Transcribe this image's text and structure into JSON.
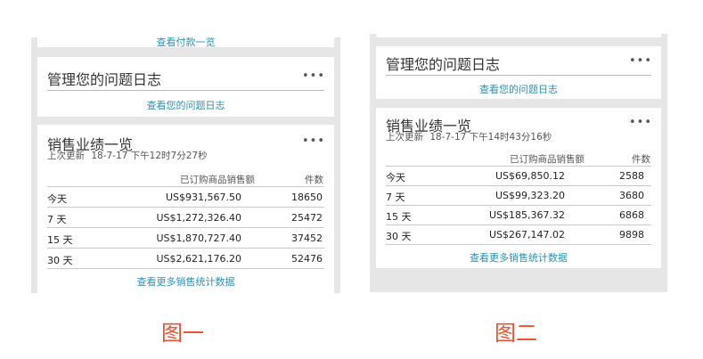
{
  "figure1": {
    "top_link": "查看付款一览",
    "issues_card": {
      "title": "管理您的问题日志",
      "more": "•••",
      "link": "查看您的问题日志"
    },
    "sales_card": {
      "title": "销售业绩一览",
      "more": "•••",
      "updated_label": "上次更新",
      "updated_value": "18-7-17 下午12时7分27秒",
      "col_sales": "已订购商品销售额",
      "col_count": "件数",
      "rows": [
        {
          "period": "今天",
          "amount": "US$931,567.50",
          "count": "18650"
        },
        {
          "period": "7 天",
          "amount": "US$1,272,326.40",
          "count": "25472"
        },
        {
          "period": "15 天",
          "amount": "US$1,870,727.40",
          "count": "37452"
        },
        {
          "period": "30 天",
          "amount": "US$2,621,176.20",
          "count": "52476"
        }
      ],
      "link": "查看更多销售统计数据"
    },
    "caption": "图一"
  },
  "figure2": {
    "issues_card": {
      "title": "管理您的问题日志",
      "more": "•••",
      "link": "查看您的问题日志"
    },
    "sales_card": {
      "title": "销售业绩一览",
      "more": "•••",
      "updated_label": "上次更新",
      "updated_value": "18-7-17 下午14时43分16秒",
      "col_sales": "已订购商品销售额",
      "col_count": "件数",
      "rows": [
        {
          "period": "今天",
          "amount": "US$69,850.12",
          "count": "2588"
        },
        {
          "period": "7 天",
          "amount": "US$99,323.20",
          "count": "3680"
        },
        {
          "period": "15 天",
          "amount": "US$185,367.32",
          "count": "6868"
        },
        {
          "period": "30 天",
          "amount": "US$267,147.02",
          "count": "9898"
        }
      ],
      "link": "查看更多销售统计数据"
    },
    "caption": "图二"
  }
}
